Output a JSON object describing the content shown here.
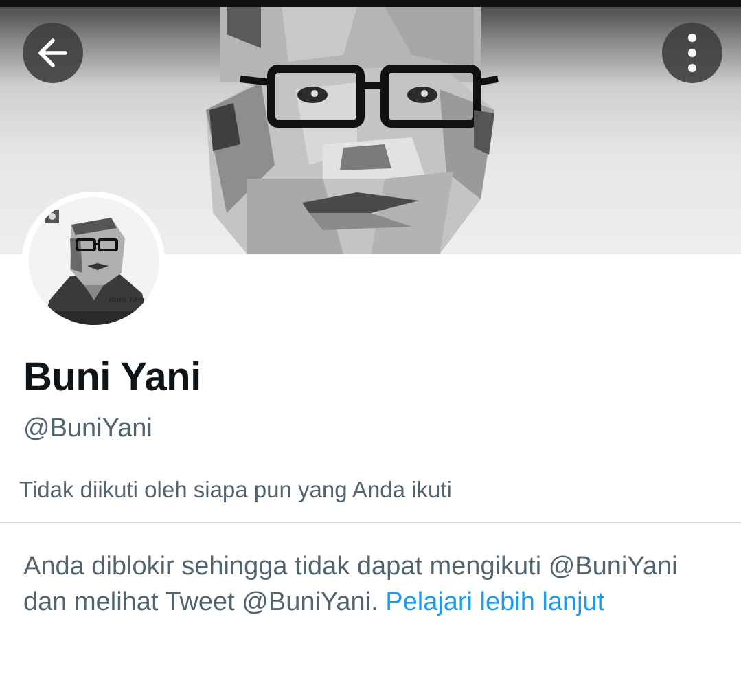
{
  "header": {
    "back_button": {
      "icon": "arrow-left-icon"
    },
    "more_button": {
      "icon": "more-vertical-icon"
    }
  },
  "profile": {
    "display_name": "Buni Yani",
    "handle": "@BuniYani",
    "followed_by_text": "Tidak diikuti oleh siapa pun yang Anda ikuti",
    "avatar_signature": "Buni Yani"
  },
  "blocked_notice": {
    "line1": "Anda diblokir sehingga tidak dapat mengikuti",
    "line2": "@BuniYani dan melihat Tweet @BuniYani.",
    "link_label": "Pelajari lebih lanjut"
  },
  "colors": {
    "text_primary": "#0f1419",
    "text_secondary": "#536471",
    "link": "#1d9bf0",
    "divider": "#cfd9de"
  }
}
